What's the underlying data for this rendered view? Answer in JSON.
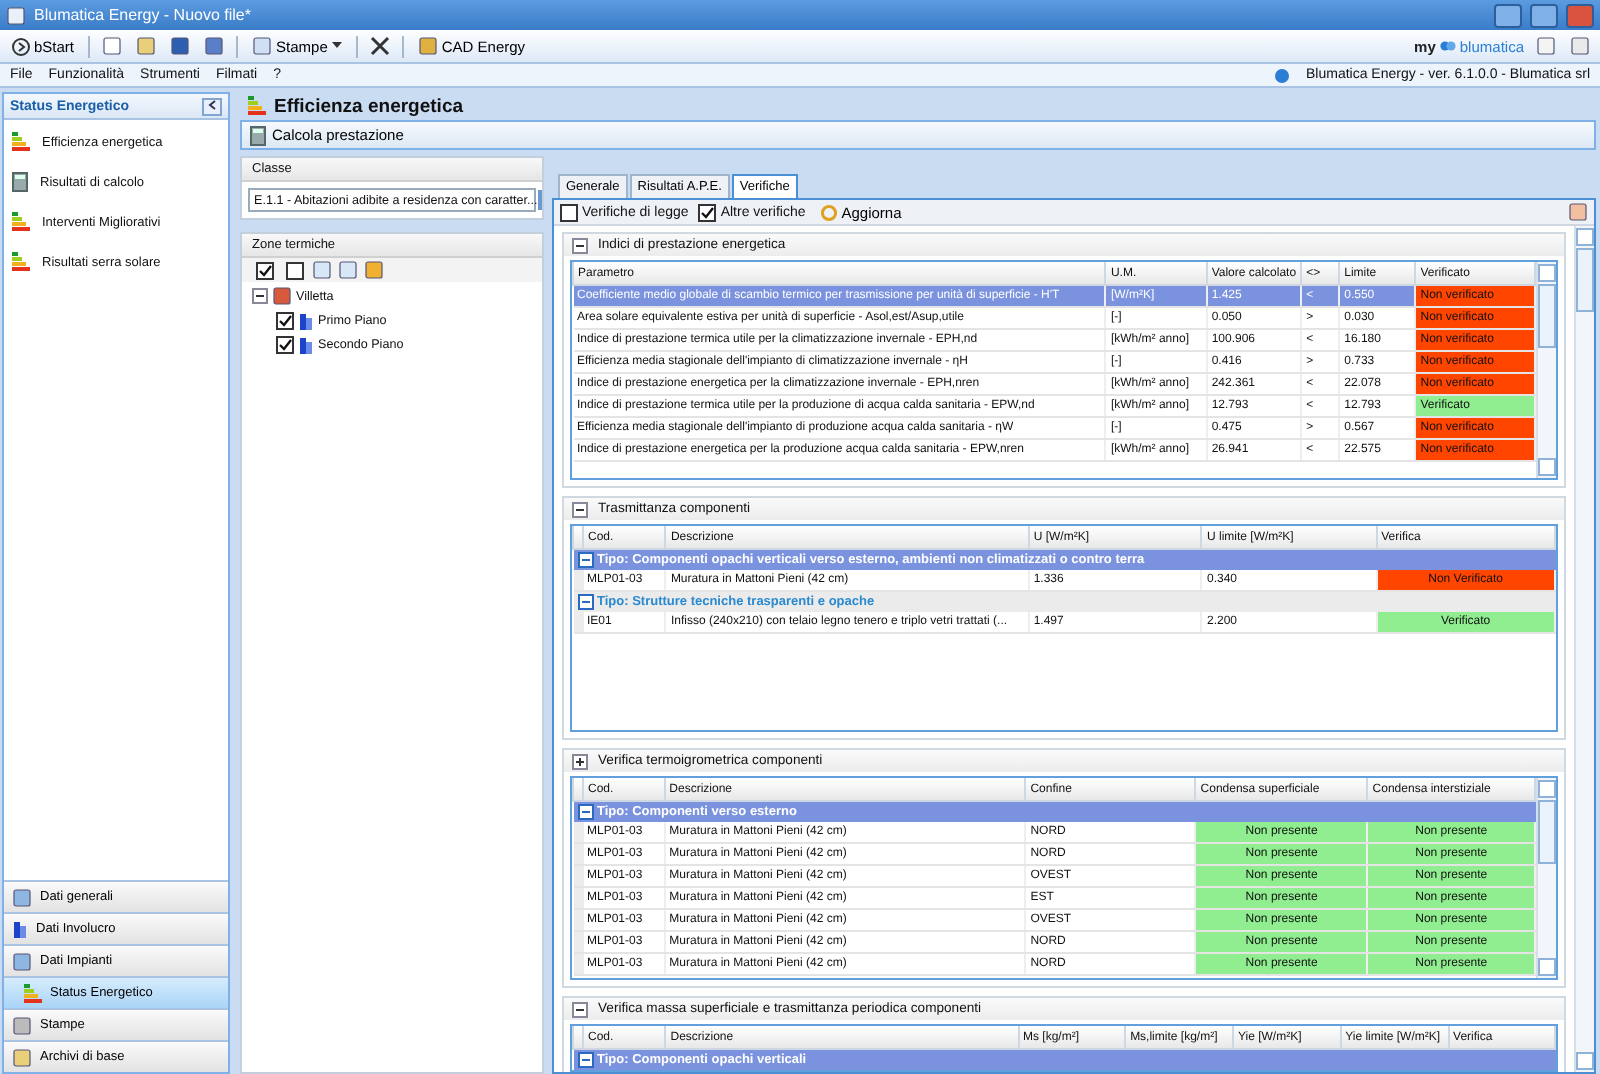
{
  "window": {
    "title": "Blumatica Energy - Nuovo file*"
  },
  "toolbar": {
    "start": "bStart",
    "print": "Stampe",
    "cad": "CAD Energy",
    "brand_prefix": "my",
    "brand_name": "blumatica"
  },
  "menu": [
    "File",
    "Funzionalità",
    "Strumenti",
    "Filmati",
    "?"
  ],
  "version": "Blumatica Energy - ver. 6.1.0.0 - Blumatica srl",
  "sidebar": {
    "title": "Status Energetico",
    "items": [
      "Efficienza energetica",
      "Risultati di calcolo",
      "Interventi Migliorativi",
      "Risultati serra solare"
    ],
    "nav": [
      {
        "label": "Dati generali",
        "selected": false
      },
      {
        "label": "Dati Involucro",
        "selected": false
      },
      {
        "label": "Dati Impianti",
        "selected": false
      },
      {
        "label": "Status Energetico",
        "selected": true
      },
      {
        "label": "Stampe",
        "selected": false
      },
      {
        "label": "Archivi di base",
        "selected": false
      }
    ]
  },
  "page": {
    "title": "Efficienza energetica",
    "action": "Calcola prestazione"
  },
  "classe": {
    "label": "Classe",
    "value": "E.1.1 - Abitazioni adibite a residenza con caratter..."
  },
  "zones": {
    "title": "Zone termiche",
    "tree": [
      {
        "label": "Villetta",
        "expanded": true,
        "children": [
          {
            "label": "Primo Piano",
            "checked": true
          },
          {
            "label": "Secondo Piano",
            "checked": true
          }
        ]
      }
    ]
  },
  "tabs": [
    {
      "label": "Generale",
      "selected": false
    },
    {
      "label": "Risultati A.P.E.",
      "selected": false
    },
    {
      "label": "Verifiche",
      "selected": true
    }
  ],
  "filters": [
    {
      "label": "Verifiche di legge",
      "checked": false
    },
    {
      "label": "Altre verifiche",
      "checked": true
    }
  ],
  "refresh": "Aggiorna",
  "sections": [
    {
      "kind": "indici",
      "title": "Indici di prestazione energetica",
      "expanded": true,
      "columns": [
        "Parametro",
        "U.M.",
        "Valore calcolato",
        "<>",
        "Limite",
        "Verificato"
      ],
      "rows": [
        {
          "cells": [
            "Coefficiente medio globale di scambio termico per trasmissione per unità di superficie - H'T",
            "[W/m²K]",
            "1.425",
            "<",
            "0.550",
            "Non verificato"
          ],
          "verified": false,
          "selected": true
        },
        {
          "cells": [
            "Area solare equivalente estiva per unità di superficie - Asol,est/Asup,utile",
            "[-]",
            "0.050",
            ">",
            "0.030",
            "Non verificato"
          ],
          "verified": false,
          "selected": false
        },
        {
          "cells": [
            "Indice di prestazione termica utile per la climatizzazione invernale - EPH,nd",
            "[kWh/m² anno]",
            "100.906",
            "<",
            "16.180",
            "Non verificato"
          ],
          "verified": false,
          "selected": false
        },
        {
          "cells": [
            "Efficienza media stagionale dell'impianto di climatizzazione invernale - ηH",
            "[-]",
            "0.416",
            ">",
            "0.733",
            "Non verificato"
          ],
          "verified": false,
          "selected": false
        },
        {
          "cells": [
            "Indice di prestazione energetica per la climatizzazione invernale - EPH,nren",
            "[kWh/m² anno]",
            "242.361",
            "<",
            "22.078",
            "Non verificato"
          ],
          "verified": false,
          "selected": false
        },
        {
          "cells": [
            "Indice di prestazione termica utile per la produzione di acqua calda sanitaria - EPW,nd",
            "[kWh/m² anno]",
            "12.793",
            "<",
            "12.793",
            "Verificato"
          ],
          "verified": true,
          "selected": false
        },
        {
          "cells": [
            "Efficienza media stagionale dell'impianto di produzione acqua calda sanitaria - ηW",
            "[-]",
            "0.475",
            ">",
            "0.567",
            "Non verificato"
          ],
          "verified": false,
          "selected": false
        },
        {
          "cells": [
            "Indice di prestazione energetica per la produzione acqua calda sanitaria - EPW,nren",
            "[kWh/m² anno]",
            "26.941",
            "<",
            "22.575",
            "Non verificato"
          ],
          "verified": false,
          "selected": false
        }
      ]
    },
    {
      "kind": "trasmittanza",
      "title": "Trasmittanza componenti",
      "expanded": true,
      "columns": [
        "Cod.",
        "Descrizione",
        "U [W/m²K]",
        "U limite [W/m²K]",
        "Verifica"
      ],
      "groups": [
        {
          "label": "Tipo: Componenti opachi verticali verso esterno, ambienti non climatizzati o contro terra",
          "selected": true,
          "rows": [
            {
              "cells": [
                "MLP01-03",
                "Muratura in Mattoni Pieni (42 cm)",
                "1.336",
                "0.340",
                "Non Verificato"
              ],
              "verified": false,
              "selected": false
            }
          ]
        },
        {
          "label": "Tipo: Strutture tecniche trasparenti e opache",
          "selected": false,
          "rows": [
            {
              "cells": [
                "IE01",
                "Infisso (240x210) con telaio legno tenero e triplo vetri trattati (...",
                "1.497",
                "2.200",
                "Verificato"
              ],
              "verified": true,
              "selected": false
            }
          ]
        }
      ]
    },
    {
      "kind": "termo",
      "title": "Verifica termoigrometrica componenti",
      "expanded": false,
      "columns": [
        "Cod.",
        "Descrizione",
        "Confine",
        "Condensa superficiale",
        "Condensa interstiziale"
      ],
      "groups": [
        {
          "label": "Tipo: Componenti verso esterno",
          "selected": true,
          "rows": [
            {
              "cells": [
                "MLP01-03",
                "Muratura in Mattoni Pieni (42 cm)",
                "NORD",
                "Non presente",
                "Non presente"
              ],
              "verified": true,
              "selected": false
            },
            {
              "cells": [
                "MLP01-03",
                "Muratura in Mattoni Pieni (42 cm)",
                "NORD",
                "Non presente",
                "Non presente"
              ],
              "verified": true,
              "selected": false
            },
            {
              "cells": [
                "MLP01-03",
                "Muratura in Mattoni Pieni (42 cm)",
                "OVEST",
                "Non presente",
                "Non presente"
              ],
              "verified": true,
              "selected": false
            },
            {
              "cells": [
                "MLP01-03",
                "Muratura in Mattoni Pieni (42 cm)",
                "EST",
                "Non presente",
                "Non presente"
              ],
              "verified": true,
              "selected": false
            },
            {
              "cells": [
                "MLP01-03",
                "Muratura in Mattoni Pieni (42 cm)",
                "OVEST",
                "Non presente",
                "Non presente"
              ],
              "verified": true,
              "selected": false
            },
            {
              "cells": [
                "MLP01-03",
                "Muratura in Mattoni Pieni (42 cm)",
                "NORD",
                "Non presente",
                "Non presente"
              ],
              "verified": true,
              "selected": false
            },
            {
              "cells": [
                "MLP01-03",
                "Muratura in Mattoni Pieni (42 cm)",
                "NORD",
                "Non presente",
                "Non presente"
              ],
              "verified": true,
              "selected": false
            }
          ]
        }
      ]
    },
    {
      "kind": "massa",
      "title": "Verifica massa superficiale e trasmittanza periodica componenti",
      "expanded": true,
      "columns": [
        "Cod.",
        "Descrizione",
        "Ms [kg/m²]",
        "Ms,limite [kg/m²]",
        "Yie [W/m²K]",
        "Yie limite [W/m²K]",
        "Verifica"
      ],
      "groups": [
        {
          "label": "Tipo: Componenti opachi verticali",
          "selected": true
        }
      ]
    }
  ]
}
